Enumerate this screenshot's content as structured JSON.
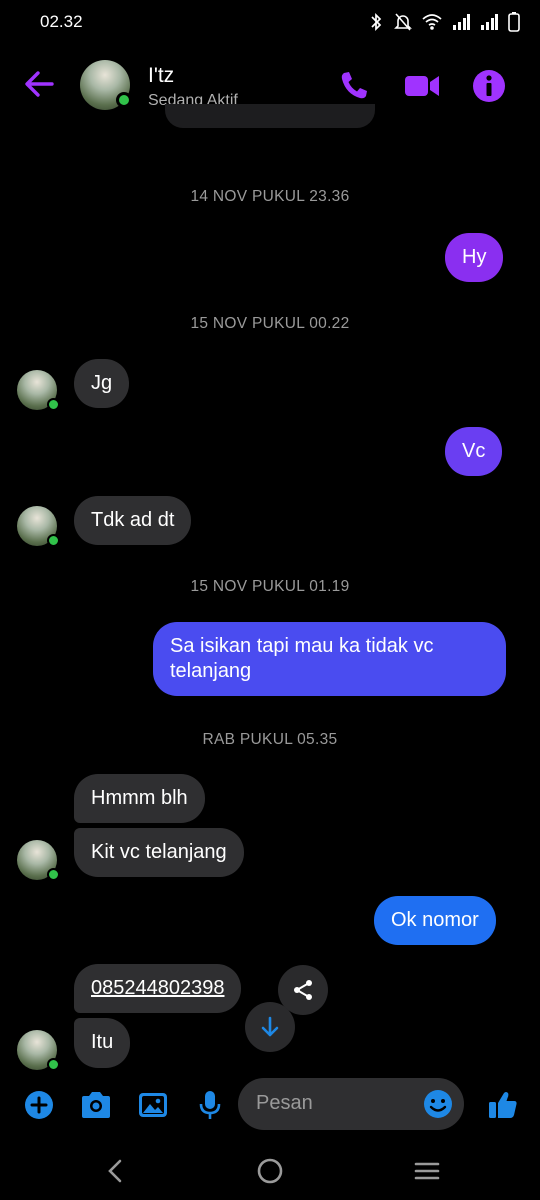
{
  "status_bar": {
    "time": "02.32"
  },
  "header": {
    "name": "I'tz",
    "status": "Sedang Aktif"
  },
  "messages": {
    "ts1": "14 NOV PUKUL 23.36",
    "m1": "Hy",
    "ts2": "15 NOV PUKUL 00.22",
    "m2": "Jg",
    "m3": "Vc",
    "m4": "Tdk ad dt",
    "ts3": "15 NOV PUKUL 01.19",
    "m5_line1": "Sa isikan tapi mau ka tidak vc",
    "m5_line2": "telanjang",
    "ts4": "RAB PUKUL 05.35",
    "m6": "Hmmm blh",
    "m7": "Kit vc telanjang",
    "m8": "Ok nomor",
    "m9": "085244802398",
    "m10": "Itu"
  },
  "composer": {
    "placeholder": "Pesan"
  },
  "colors": {
    "accent": "#a033ff",
    "blue_bubble": "#1f6ff2",
    "mid_bubble": "#4a4cf0",
    "purple_bubble": "#8a2ff0",
    "messenger_blue": "#1e88e5"
  }
}
